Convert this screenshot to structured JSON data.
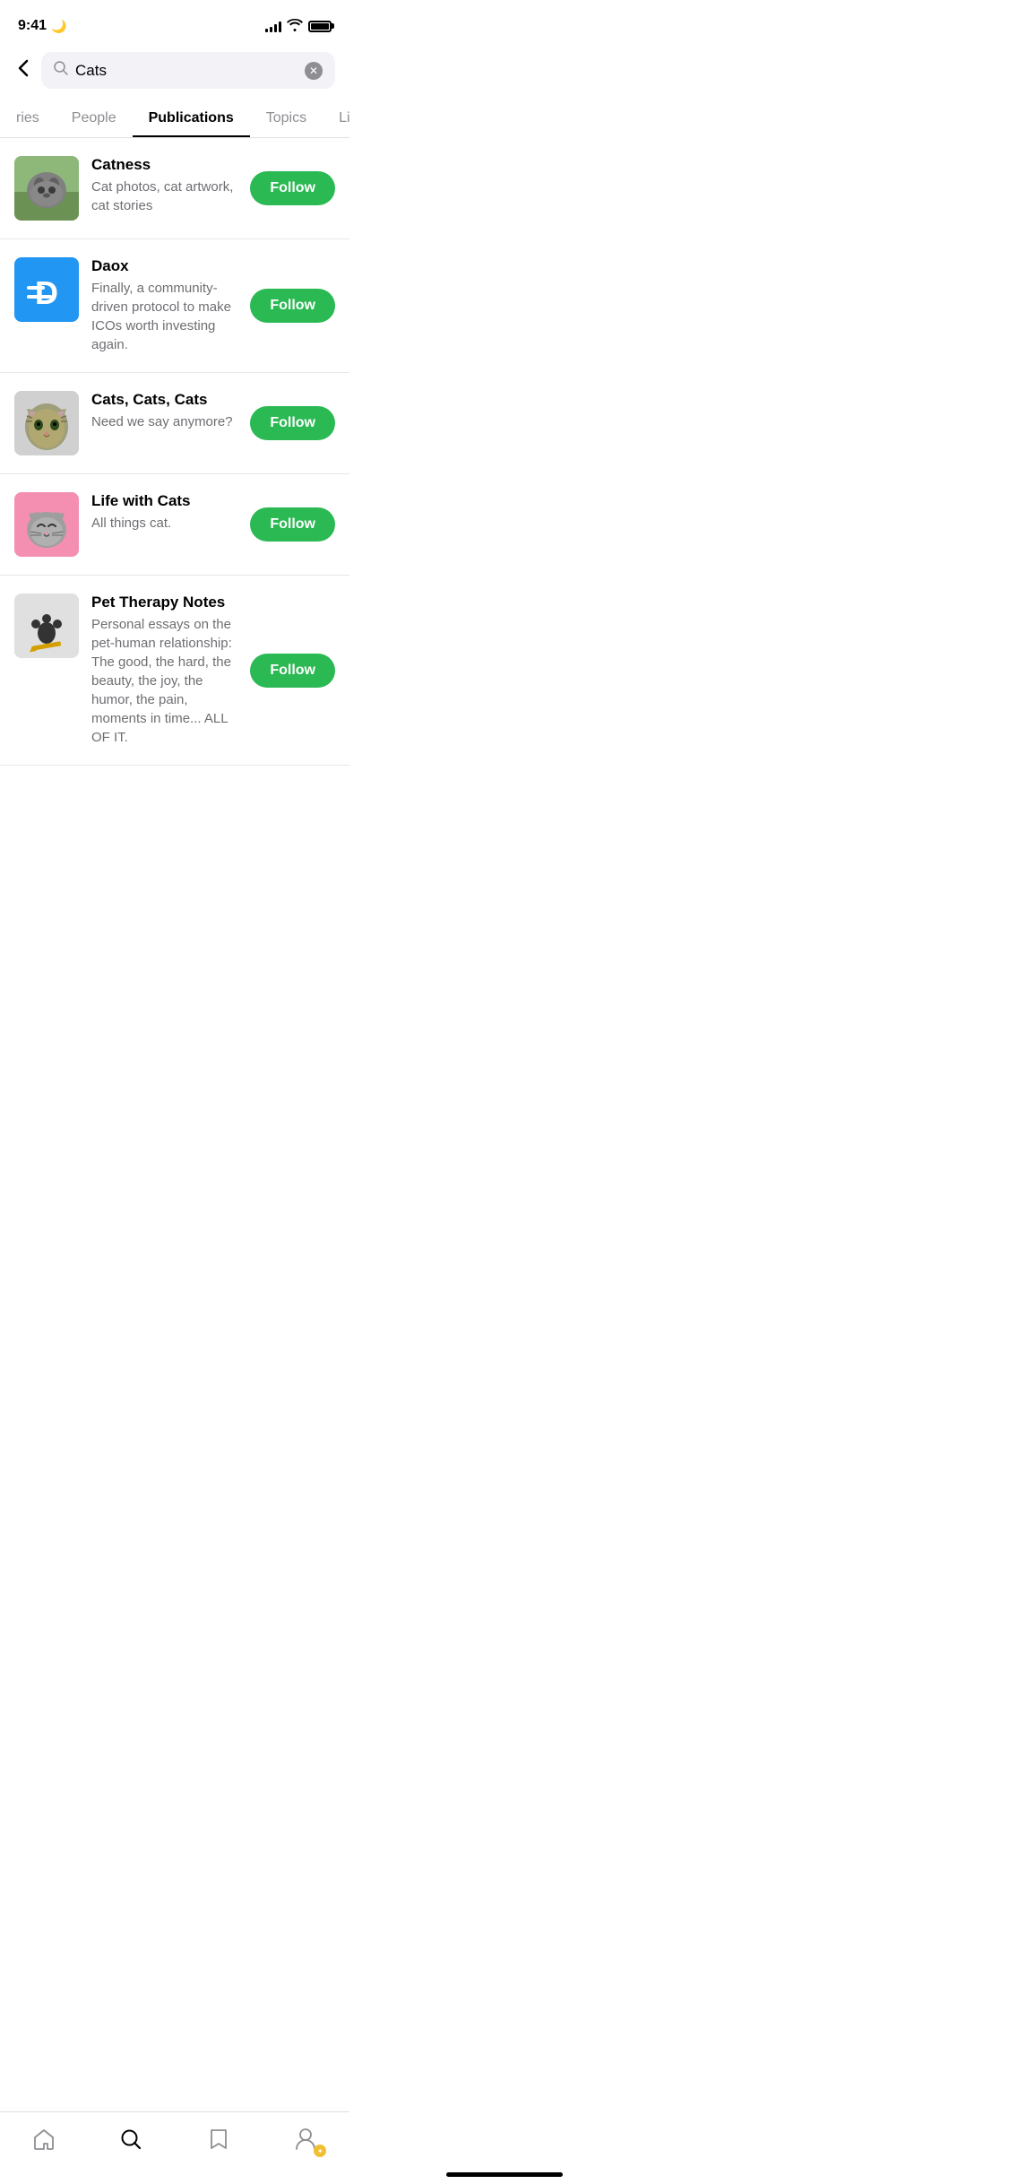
{
  "statusBar": {
    "time": "9:41",
    "moonIcon": "🌙"
  },
  "searchBar": {
    "query": "Cats",
    "placeholder": "Search",
    "backLabel": "<",
    "clearLabel": "✕"
  },
  "tabs": [
    {
      "id": "stories",
      "label": "ries",
      "active": false
    },
    {
      "id": "people",
      "label": "People",
      "active": false
    },
    {
      "id": "publications",
      "label": "Publications",
      "active": true
    },
    {
      "id": "topics",
      "label": "Topics",
      "active": false
    },
    {
      "id": "lists",
      "label": "Lists",
      "active": false
    }
  ],
  "publications": [
    {
      "id": "catness",
      "name": "Catness",
      "description": "Cat photos, cat artwork, cat stories",
      "followLabel": "Follow",
      "avatarType": "catness",
      "avatarEmoji": "🐱"
    },
    {
      "id": "daox",
      "name": "Daox",
      "description": "Finally, a community-driven protocol to make ICOs worth investing again.",
      "followLabel": "Follow",
      "avatarType": "daox",
      "avatarEmoji": "D"
    },
    {
      "id": "cats3",
      "name": "Cats, Cats, Cats",
      "description": "Need we say anymore?",
      "followLabel": "Follow",
      "avatarType": "cats3",
      "avatarEmoji": "🐈"
    },
    {
      "id": "lifewithcats",
      "name": "Life with Cats",
      "description": "All things cat.",
      "followLabel": "Follow",
      "avatarType": "lifewithcats",
      "avatarEmoji": "🐱"
    },
    {
      "id": "pettherapy",
      "name": "Pet Therapy Notes",
      "description": "Personal essays on the pet-human relationship: The good, the hard, the beauty, the joy, the humor, the pain, moments in time... ALL OF IT.",
      "followLabel": "Follow",
      "avatarType": "pettherapy",
      "avatarEmoji": "🐾"
    }
  ],
  "bottomNav": {
    "homeLabel": "⌂",
    "searchLabel": "○",
    "bookmarkLabel": "⊓",
    "profileLabel": "👤",
    "badgeLabel": "✦"
  }
}
